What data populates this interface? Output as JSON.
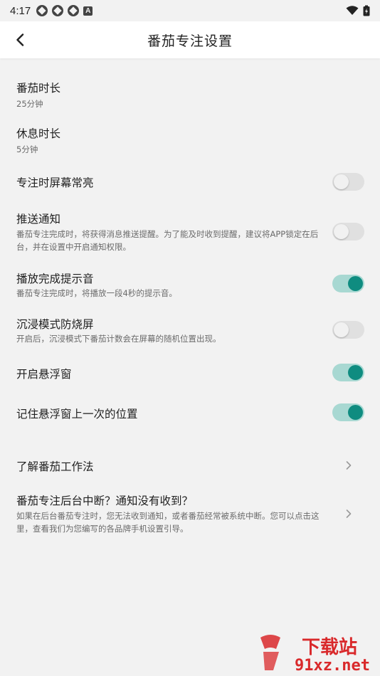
{
  "status_bar": {
    "time": "4:17",
    "badge_letter": "A"
  },
  "header": {
    "title": "番茄专注设置"
  },
  "settings": [
    {
      "title": "番茄时长",
      "subtitle": "25分钟"
    },
    {
      "title": "休息时长",
      "subtitle": "5分钟"
    },
    {
      "title": "专注时屏幕常亮",
      "toggle": false
    },
    {
      "title": "推送通知",
      "subtitle": "番茄专注完成时，将获得消息推送提醒。为了能及时收到提醒，建议将APP锁定在后台，并在设置中开启通知权限。",
      "toggle": false
    },
    {
      "title": "播放完成提示音",
      "subtitle": "番茄专注完成时，将播放一段4秒的提示音。",
      "toggle": true
    },
    {
      "title": "沉浸模式防烧屏",
      "subtitle": "开启后，沉浸模式下番茄计数会在屏幕的随机位置出现。",
      "toggle": false
    },
    {
      "title": "开启悬浮窗",
      "toggle": true
    },
    {
      "title": "记住悬浮窗上一次的位置",
      "toggle": true
    },
    {
      "title": "了解番茄工作法"
    },
    {
      "title": "番茄专注后台中断？通知没有收到？",
      "subtitle": "如果在后台番茄专注时，您无法收到通知，或者番茄经常被系统中断。您可以点击这里，查看我们为您编写的各品牌手机设置引导。"
    }
  ],
  "watermark": {
    "line1": "下载站",
    "line2": "91xz.net"
  },
  "colors": {
    "accent": "#0f8c80",
    "accent_track": "#a8d8d2",
    "background": "#f2f2f2"
  }
}
